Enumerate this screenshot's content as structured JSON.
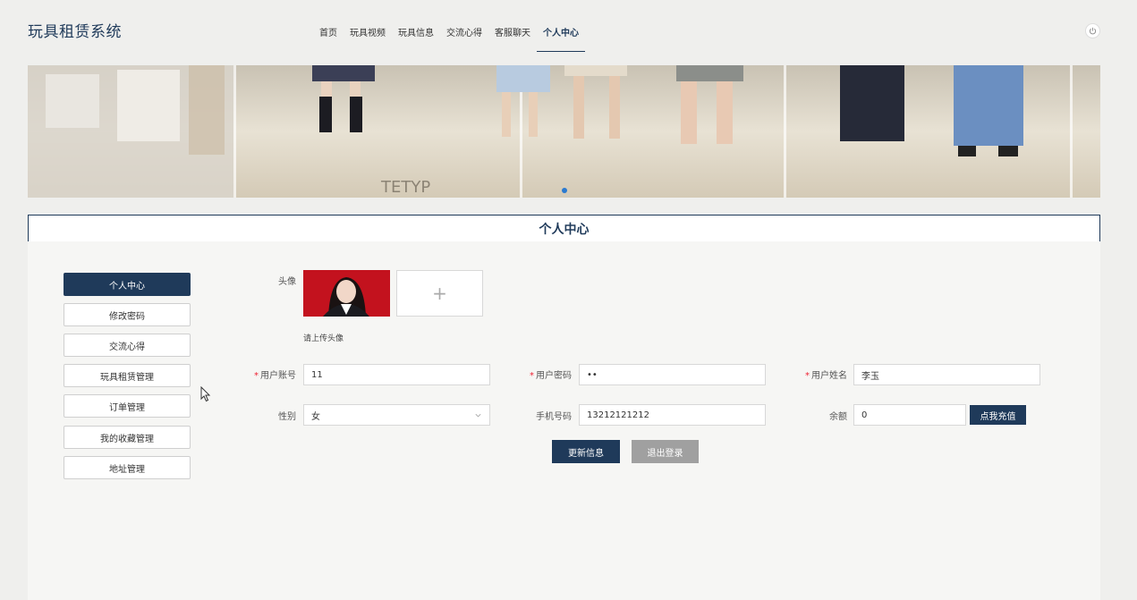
{
  "site": {
    "title": "玩具租赁系统"
  },
  "nav": {
    "items": [
      {
        "label": "首页",
        "active": false
      },
      {
        "label": "玩具视频",
        "active": false
      },
      {
        "label": "玩具信息",
        "active": false
      },
      {
        "label": "交流心得",
        "active": false
      },
      {
        "label": "客服聊天",
        "active": false
      },
      {
        "label": "个人中心",
        "active": true
      }
    ]
  },
  "page": {
    "title": "个人中心"
  },
  "sidebar": {
    "items": [
      {
        "label": "个人中心",
        "active": true
      },
      {
        "label": "修改密码",
        "active": false
      },
      {
        "label": "交流心得",
        "active": false
      },
      {
        "label": "玩具租赁管理",
        "active": false
      },
      {
        "label": "订单管理",
        "active": false
      },
      {
        "label": "我的收藏管理",
        "active": false
      },
      {
        "label": "地址管理",
        "active": false
      }
    ]
  },
  "form": {
    "avatar_label": "头像",
    "upload_hint": "请上传头像",
    "upload_plus": "+",
    "account_label": "用户账号",
    "account_value": "11",
    "password_label": "用户密码",
    "password_value": "••",
    "name_label": "用户姓名",
    "name_value": "李玉",
    "gender_label": "性别",
    "gender_value": "女",
    "phone_label": "手机号码",
    "phone_value": "13212121212",
    "balance_label": "余额",
    "balance_value": "0",
    "required_mark": "*",
    "recharge_button": "点我充值",
    "update_button": "更新信息",
    "logout_button": "退出登录"
  },
  "colors": {
    "accent": "#1f3a5a",
    "required": "#ee2233",
    "gray_button": "#a0a0a0"
  }
}
